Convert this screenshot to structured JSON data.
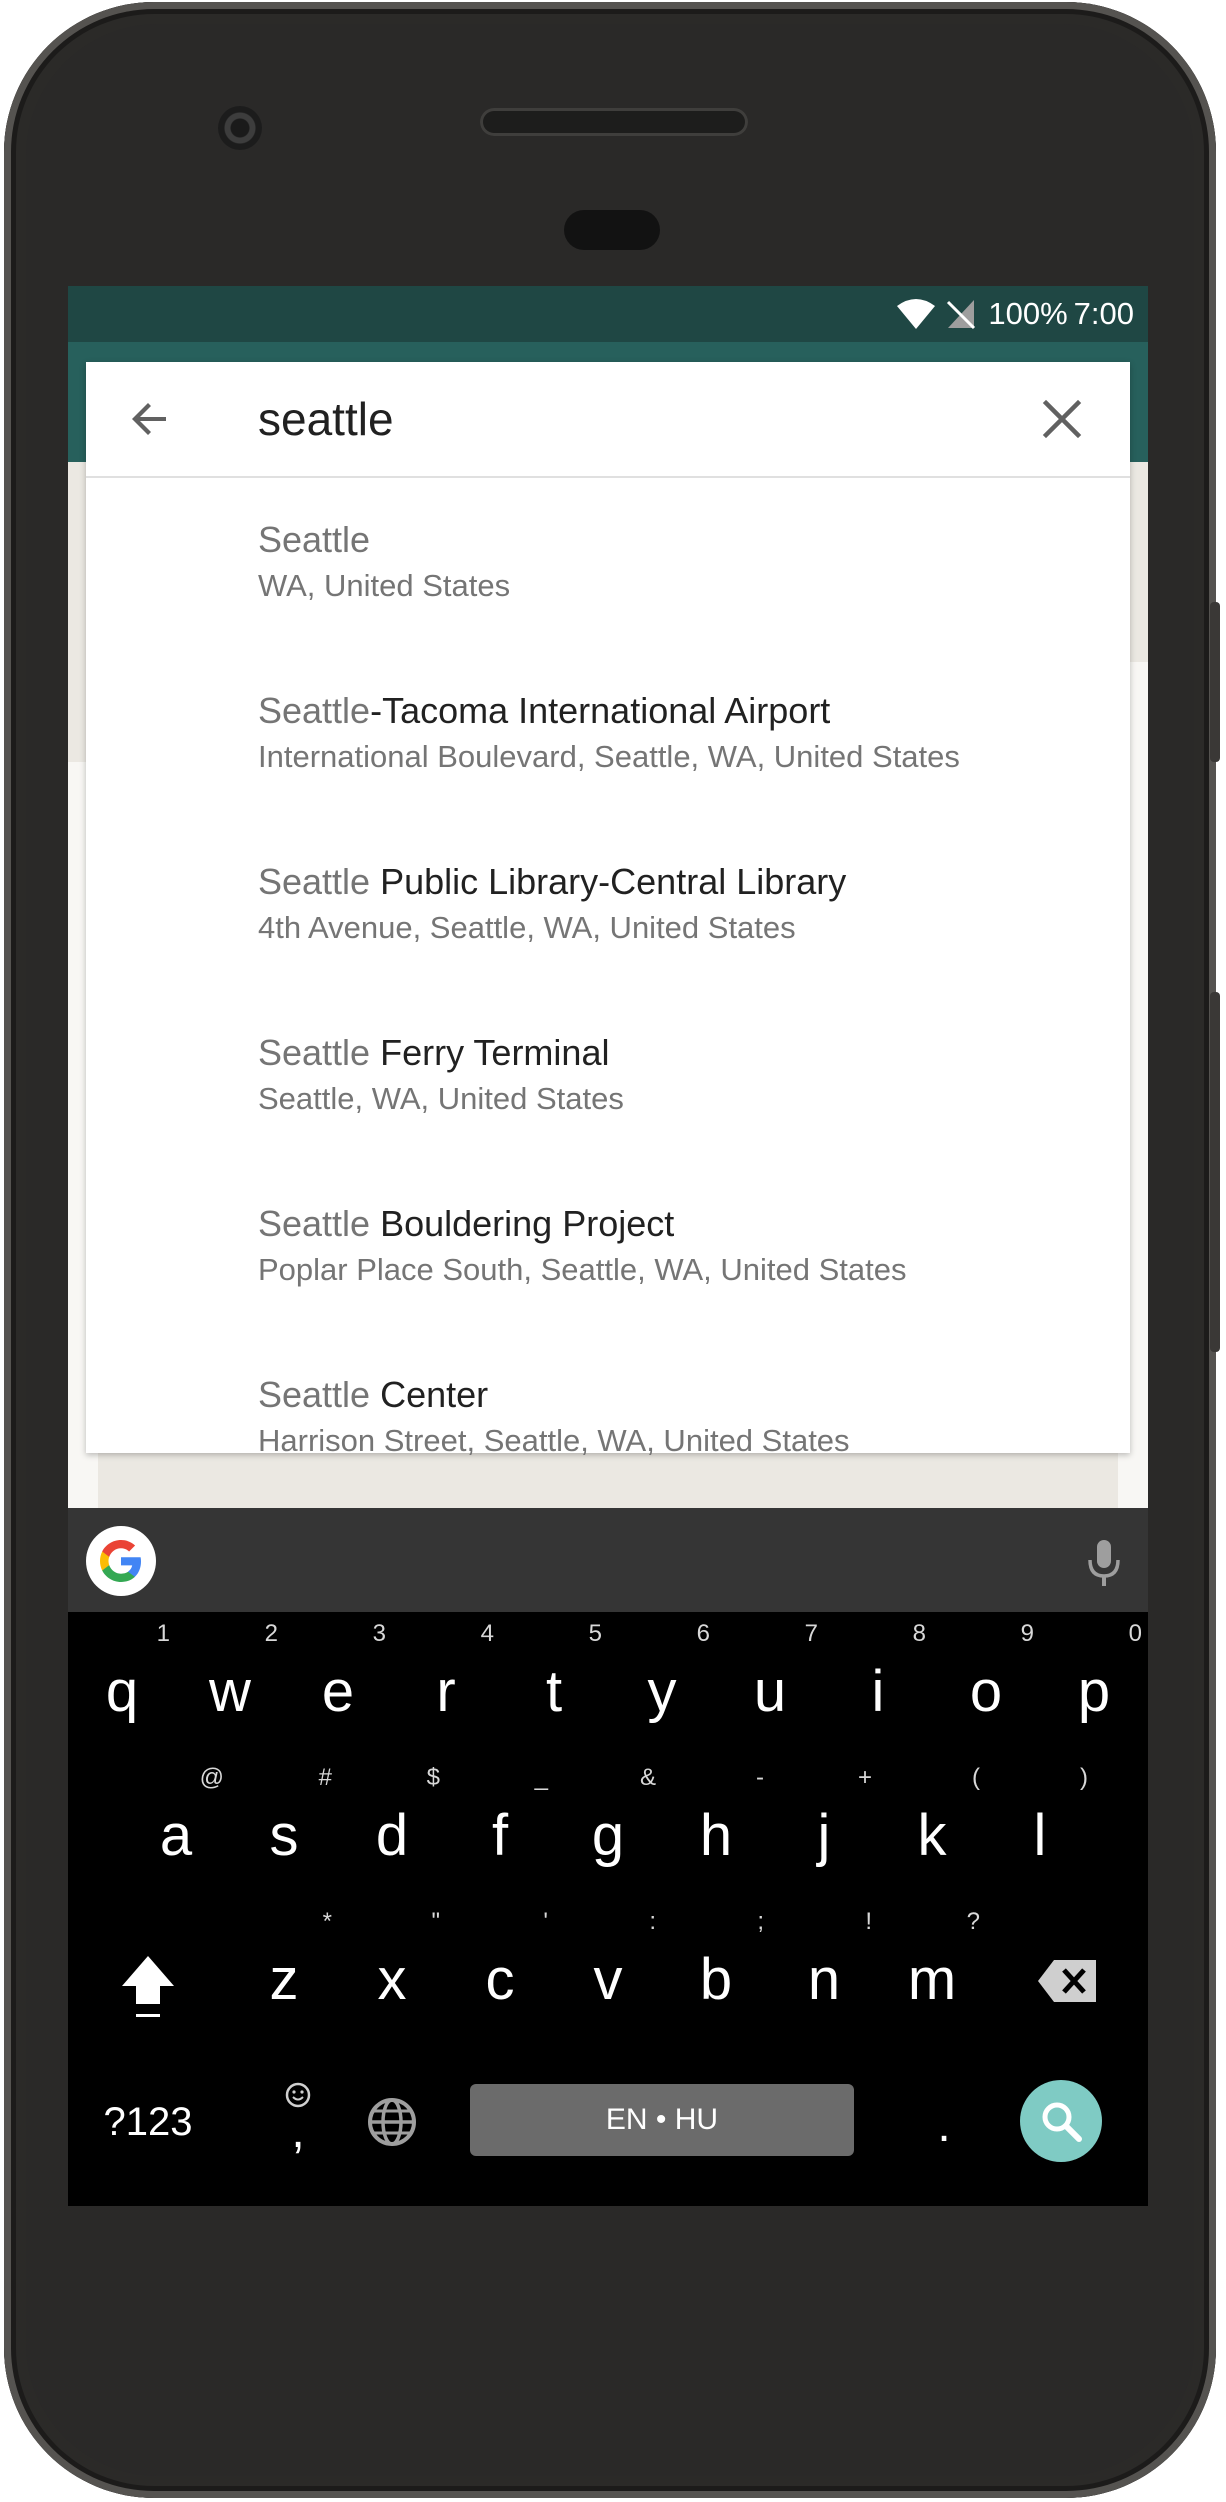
{
  "status_bar": {
    "battery": "100%",
    "time": "7:00"
  },
  "search": {
    "query": "seattle"
  },
  "results": [
    {
      "match": "Seattle",
      "rest": "",
      "subtitle": "WA, United States"
    },
    {
      "match": "Seattle",
      "rest": "-Tacoma International Airport",
      "subtitle": "International Boulevard, Seattle, WA, United States"
    },
    {
      "match": "Seattle",
      "rest": " Public Library-Central Library",
      "subtitle": "4th Avenue, Seattle, WA, United States"
    },
    {
      "match": "Seattle",
      "rest": " Ferry Terminal",
      "subtitle": "Seattle, WA, United States"
    },
    {
      "match": "Seattle",
      "rest": " Bouldering Project",
      "subtitle": "Poplar Place South, Seattle, WA, United States"
    },
    {
      "match": "Seattle",
      "rest": " Center",
      "subtitle": "Harrison Street, Seattle, WA, United States"
    }
  ],
  "keyboard": {
    "row1": [
      {
        "key": "q",
        "hint": "1"
      },
      {
        "key": "w",
        "hint": "2"
      },
      {
        "key": "e",
        "hint": "3"
      },
      {
        "key": "r",
        "hint": "4"
      },
      {
        "key": "t",
        "hint": "5"
      },
      {
        "key": "y",
        "hint": "6"
      },
      {
        "key": "u",
        "hint": "7"
      },
      {
        "key": "i",
        "hint": "8"
      },
      {
        "key": "o",
        "hint": "9"
      },
      {
        "key": "p",
        "hint": "0"
      }
    ],
    "row2": [
      {
        "key": "a",
        "hint": "@"
      },
      {
        "key": "s",
        "hint": "#"
      },
      {
        "key": "d",
        "hint": "$"
      },
      {
        "key": "f",
        "hint": "_"
      },
      {
        "key": "g",
        "hint": "&"
      },
      {
        "key": "h",
        "hint": "-"
      },
      {
        "key": "j",
        "hint": "+"
      },
      {
        "key": "k",
        "hint": "("
      },
      {
        "key": "l",
        "hint": ")"
      }
    ],
    "row3": [
      {
        "key": "z",
        "hint": "*"
      },
      {
        "key": "x",
        "hint": "\""
      },
      {
        "key": "c",
        "hint": "'"
      },
      {
        "key": "v",
        "hint": ":"
      },
      {
        "key": "b",
        "hint": ";"
      },
      {
        "key": "n",
        "hint": "!"
      },
      {
        "key": "m",
        "hint": "?"
      }
    ],
    "symbols_label": "?123",
    "comma_label": ",",
    "space_label": "EN • HU",
    "period_label": "."
  },
  "icons": {
    "back": "arrow-back-icon",
    "clear": "close-icon",
    "google": "google-g-icon",
    "mic": "microphone-icon",
    "shift": "shift-icon",
    "backspace": "backspace-icon",
    "globe": "globe-icon",
    "emoji": "emoji-icon",
    "search": "search-icon",
    "wifi": "wifi-icon",
    "signal": "no-signal-icon"
  },
  "colors": {
    "status_bar": "#1f4744",
    "toolbar": "#27605c",
    "search_key": "#7fcbc4"
  }
}
